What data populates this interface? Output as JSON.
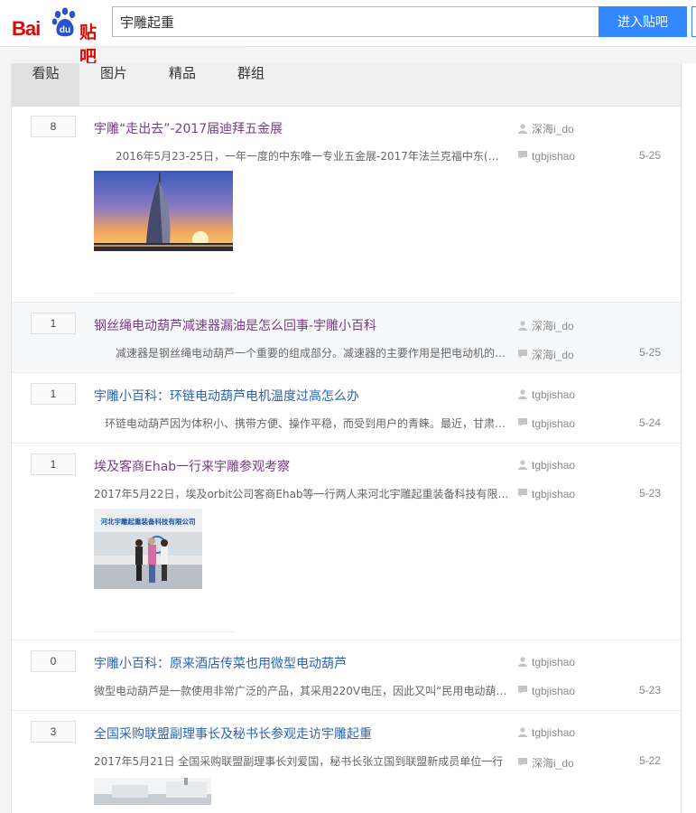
{
  "header": {
    "logo_text": "Bai",
    "logo_du": "du",
    "logo_tieba": "贴吧",
    "search_value": "宇雕起重",
    "search_button": "进入贴吧"
  },
  "tabs": [
    {
      "label": "看贴",
      "active": true
    },
    {
      "label": "图片",
      "active": false
    },
    {
      "label": "精品",
      "active": false
    },
    {
      "label": "群组",
      "active": false
    }
  ],
  "threads": [
    {
      "replies": "8",
      "title": "宇雕“走出去”-2017届迪拜五金展",
      "abstract": "2016年5月23-25日，一年一度的中东唯一专业五金展-2017年法兰克福中东(迪拜)五金展",
      "author": "深海i_do",
      "last_reply": "tgbjishao",
      "date": "5-25"
    },
    {
      "replies": "1",
      "title": "钢丝绳电动葫芦减速器漏油是怎么回事-宇雕小百科",
      "abstract": "减速器是钢丝绳电动葫芦一个重要的组成部分。减速器的主要作用是把电动机的转速降低",
      "author": "深海i_do",
      "last_reply": "深海i_do",
      "date": "5-25"
    },
    {
      "replies": "1",
      "title": "宇雕小百科：环链电动葫芦电机温度过高怎么办",
      "abstract": "环链电动葫芦因为体积小、携带方便、操作平稳，而受到用户的青睐。最近，甘肃的用户",
      "author": "tgbjishao",
      "last_reply": "tgbjishao",
      "date": "5-24"
    },
    {
      "replies": "1",
      "title": "埃及客商Ehab一行来宇雕参观考察",
      "abstract": "2017年5月22日，埃及orbit公司客商Ehab等一行两人来河北宇雕起重装备科技有限公司参观",
      "author": "tgbjishao",
      "last_reply": "tgbjishao",
      "date": "5-23"
    },
    {
      "replies": "0",
      "title": "宇雕小百科：原来酒店传菜也用微型电动葫芦",
      "abstract": "微型电动葫芦是一款使用非常广泛的产品，其采用220V电压，因此又叫“民用电动葫芦”",
      "author": "tgbjishao",
      "last_reply": "tgbjishao",
      "date": "5-23"
    },
    {
      "replies": "3",
      "title": "全国采购联盟副理事长及秘书长参观走访宇雕起重",
      "abstract": "2017年5月21日 全国采购联盟副理事长刘爱国，秘书长张立国到联盟新成员单位一行",
      "author": "tgbjishao",
      "last_reply": "深海i_do",
      "date": "5-22"
    }
  ],
  "photo_banner": "河北宇雕起重装备科技有限公司",
  "colors": {
    "accent": "#3388ff",
    "brand": "#e10602",
    "link": "#2d64b3",
    "visited": "#7a3a8c"
  }
}
